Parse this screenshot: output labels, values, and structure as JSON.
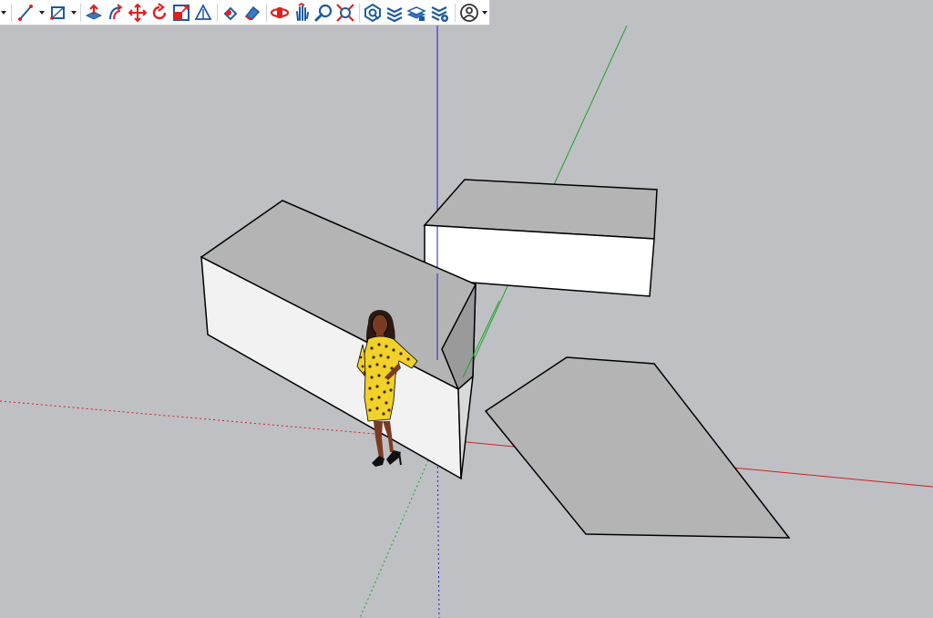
{
  "colors": {
    "background": "#bfc0c4",
    "toolbar_bg": "#ffffff",
    "icon_blue": "#1f5a9e",
    "icon_red": "#e02020",
    "axis_red": "#d02020",
    "axis_green": "#1fa32a",
    "axis_blue": "#2020c0",
    "face_light": "#f2f2f2",
    "face_white": "#ffffff",
    "face_top": "#b4b4b4",
    "face_dark": "#9a9a9a",
    "edge": "#000000",
    "figure_dress": "#f1d12a",
    "figure_skin": "#7a3b22"
  },
  "toolbar": {
    "items": [
      {
        "name": "line-tool",
        "icon": "pencil-line-icon",
        "has_menu": true
      },
      {
        "name": "arc-tool",
        "icon": "arc-icon",
        "has_menu": true
      },
      {
        "name": "shape-tool",
        "icon": "rectangle-icon",
        "has_menu": true
      },
      {
        "name": "push-pull-tool",
        "icon": "push-pull-icon"
      },
      {
        "name": "offset-tool",
        "icon": "offset-icon"
      },
      {
        "name": "move-tool",
        "icon": "move-icon"
      },
      {
        "name": "rotate-tool",
        "icon": "rotate-icon"
      },
      {
        "name": "scale-tool",
        "icon": "scale-icon"
      },
      {
        "name": "tape-measure-tool",
        "icon": "tape-measure-icon"
      },
      {
        "name": "paint-bucket-tool",
        "icon": "paint-bucket-icon"
      },
      {
        "name": "eraser-tool",
        "icon": "eraser-icon"
      },
      {
        "name": "orbit-tool",
        "icon": "orbit-icon"
      },
      {
        "name": "pan-tool",
        "icon": "pan-hand-icon"
      },
      {
        "name": "zoom-tool",
        "icon": "zoom-icon"
      },
      {
        "name": "zoom-extents-tool",
        "icon": "zoom-extents-icon"
      },
      {
        "name": "warehouse-tool",
        "icon": "warehouse-icon"
      },
      {
        "name": "extension-tool",
        "icon": "extension-icon"
      },
      {
        "name": "layers-tool",
        "icon": "layers-icon"
      },
      {
        "name": "extension-manager-tool",
        "icon": "extension-manager-icon"
      },
      {
        "name": "account-tool",
        "icon": "user-account-icon",
        "has_menu": true
      }
    ]
  },
  "scene": {
    "objects": [
      "long-box",
      "white-box",
      "ground-face",
      "person-figure"
    ]
  }
}
